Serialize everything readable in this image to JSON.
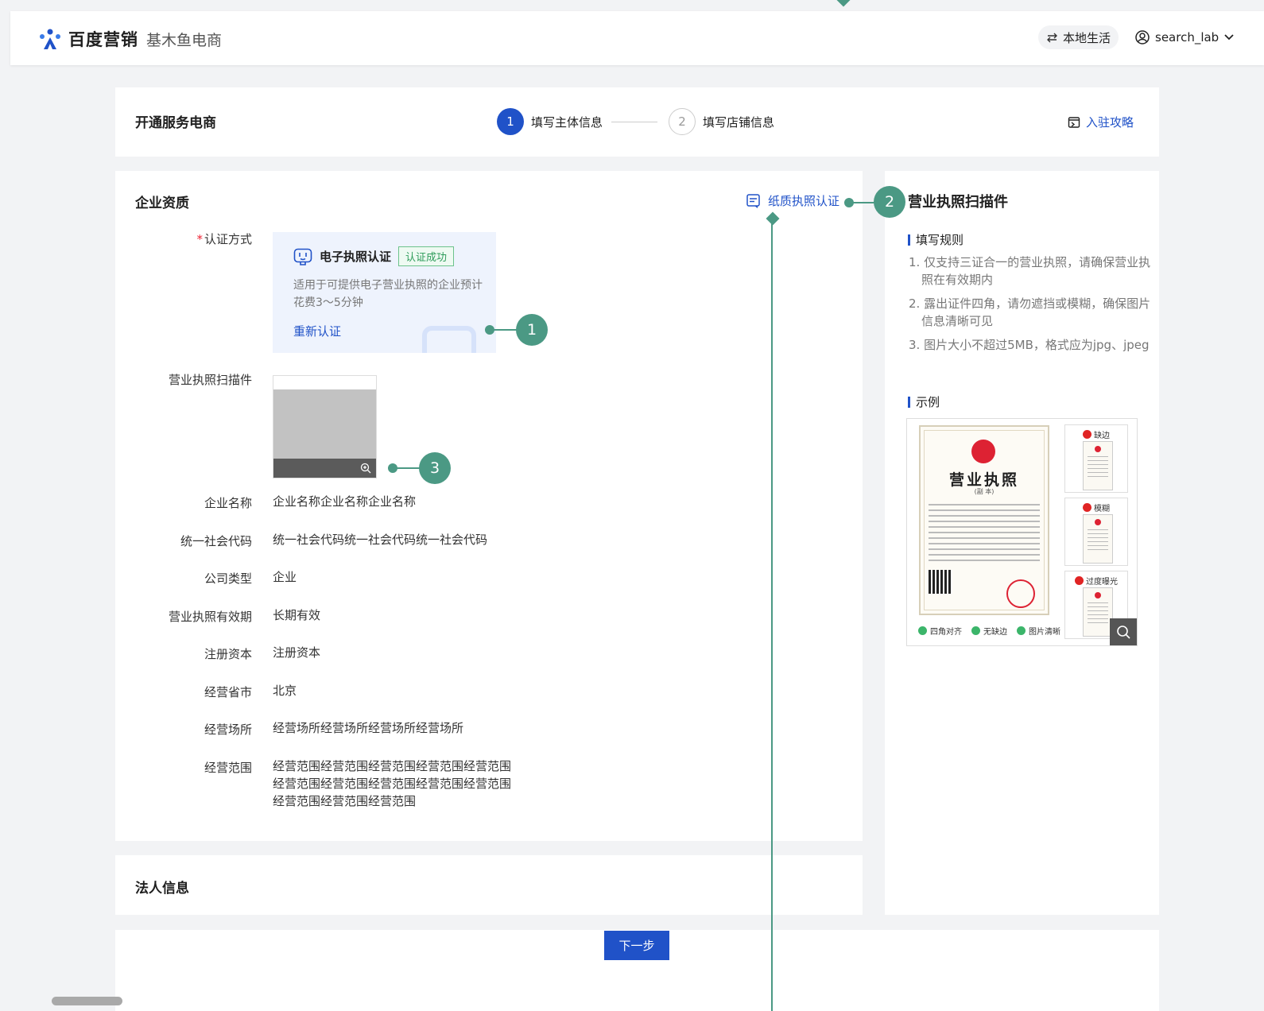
{
  "header": {
    "brand_name": "百度营销",
    "brand_sub": "基木鱼电商",
    "local_life": "本地生活",
    "username": "search_lab"
  },
  "steps": {
    "title": "开通服务电商",
    "items": [
      {
        "num": "1",
        "label": "填写主体信息"
      },
      {
        "num": "2",
        "label": "填写店铺信息"
      }
    ],
    "guide_link": "入驻攻略"
  },
  "qualification": {
    "title": "企业资质",
    "paper_link": "纸质执照认证",
    "auth_label": "认证方式",
    "auth_method": "电子执照认证",
    "auth_status": "认证成功",
    "auth_desc": "适用于可提供电子营业执照的企业预计花费3～5分钟",
    "reauth": "重新认证",
    "license_label": "营业执照扫描件",
    "fields": [
      {
        "label": "企业名称",
        "value": "企业名称企业名称企业名称"
      },
      {
        "label": "统一社会代码",
        "value": "统一社会代码统一社会代码统一社会代码"
      },
      {
        "label": "公司类型",
        "value": "企业"
      },
      {
        "label": "营业执照有效期",
        "value": "长期有效"
      },
      {
        "label": "注册资本",
        "value": "注册资本"
      },
      {
        "label": "经营省市",
        "value": "北京"
      },
      {
        "label": "经营场所",
        "value": "经营场所经营场所经营场所经营场所"
      },
      {
        "label": "经营范围",
        "value": "经营范围经营范围经营范围经营范围经营范围经营范围经营范围经营范围经营范围经营范围经营范围经营范围经营范围"
      }
    ]
  },
  "legal": {
    "title": "法人信息"
  },
  "side": {
    "title": "营业执照扫描件",
    "rules_head": "填写规则",
    "rules": [
      "1. 仅支持三证合一的营业执照，请确保营业执照在有效期内",
      "2. 露出证件四角，请勿遮挡或模糊，确保图片信息清晰可见",
      "3. 图片大小不超过5MB，格式应为jpg、jpeg"
    ],
    "example_head": "示例",
    "license_title": "营业执照",
    "license_sub": "(副 本)",
    "checks": [
      "四角对齐",
      "无缺边",
      "图片清晰"
    ],
    "bad_examples": [
      "缺边",
      "模糊",
      "过度曝光"
    ]
  },
  "footer": {
    "next": "下一步"
  },
  "annotations": [
    "1",
    "2",
    "3"
  ],
  "colors": {
    "primary": "#2052c8",
    "annotation": "#4b9984",
    "success": "#3bb56a",
    "error": "#e02424"
  }
}
